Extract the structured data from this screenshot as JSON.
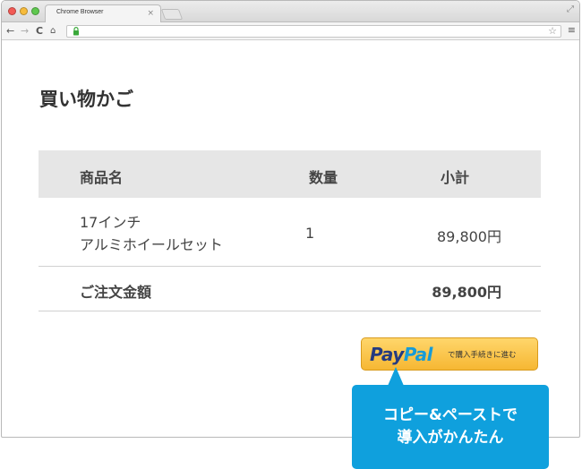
{
  "browser": {
    "tab_title": "Chrome Browser",
    "tab_close": "×",
    "resize_glyph": "⤢",
    "nav_back": "←",
    "nav_forward": "→",
    "nav_reload": "C",
    "nav_home": "⌂",
    "star": "☆",
    "menu": "≡"
  },
  "page": {
    "title": "買い物かご"
  },
  "cart": {
    "headers": {
      "name": "商品名",
      "qty": "数量",
      "subtotal": "小計"
    },
    "items": [
      {
        "name_line1": "17インチ",
        "name_line2": "アルミホイールセット",
        "qty": "1",
        "subtotal": "89,800円"
      }
    ],
    "total_label": "ご注文金額",
    "total_value": "89,800円"
  },
  "paypal": {
    "logo_pay": "Pay",
    "logo_pal": "Pal",
    "text": "で購入手続きに進む"
  },
  "callout": {
    "line1": "コピー&ペーストで",
    "line2": "導入がかんたん"
  },
  "colors": {
    "callout_bg": "#0fa0dd",
    "paypal_bg": "#f6b733",
    "header_bg": "#e6e6e6"
  }
}
